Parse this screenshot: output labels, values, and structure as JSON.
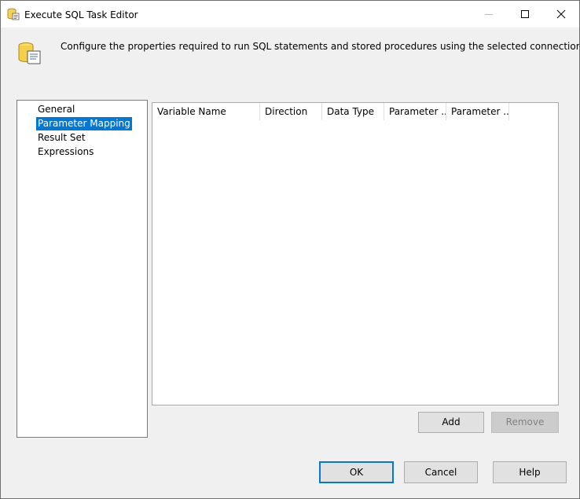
{
  "window": {
    "title": "Execute SQL Task Editor",
    "icon": "sql-task-icon",
    "controls": {
      "minimize": "minimize-icon",
      "maximize": "maximize-icon",
      "close": "close-icon"
    }
  },
  "header": {
    "icon": "database-scroll-icon",
    "description": "Configure the properties required to run SQL statements and stored procedures using the selected connection."
  },
  "nav": {
    "items": [
      {
        "label": "General",
        "selected": false
      },
      {
        "label": "Parameter Mapping",
        "selected": true
      },
      {
        "label": "Result Set",
        "selected": false
      },
      {
        "label": "Expressions",
        "selected": false
      }
    ]
  },
  "grid": {
    "columns": [
      "Variable Name",
      "Direction",
      "Data Type",
      "Parameter ...",
      "Parameter ..."
    ],
    "rows": []
  },
  "grid_buttons": {
    "add_label": "Add",
    "remove_label": "Remove"
  },
  "footer": {
    "ok_label": "OK",
    "cancel_label": "Cancel",
    "help_label": "Help"
  },
  "colors": {
    "accent": "#0078d7",
    "window_bg": "#f0f0f0"
  }
}
